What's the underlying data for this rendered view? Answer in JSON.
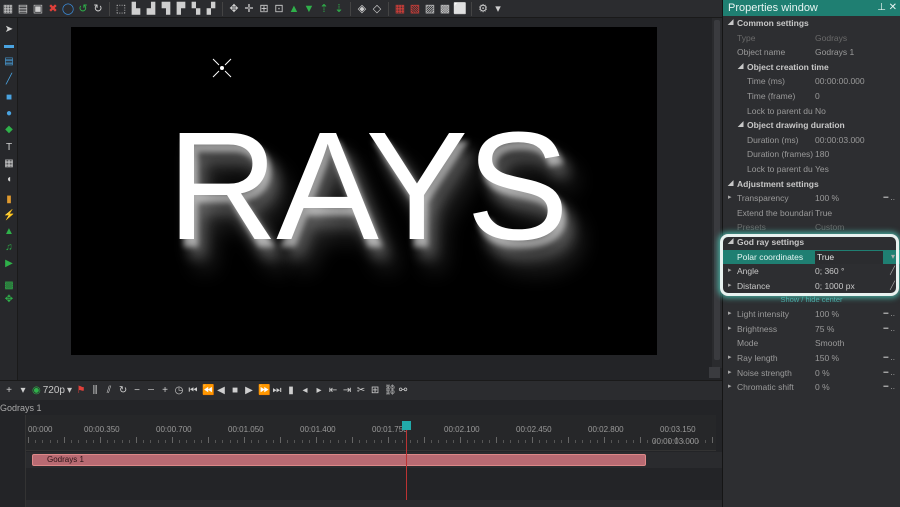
{
  "canvas": {
    "text": "RAYS"
  },
  "timeline": {
    "resolution": "720p",
    "track_name": "Godrays 1",
    "clip_label": "Godrays 1",
    "ticks": [
      "00:000",
      "00:00.350",
      "00:00.700",
      "00:01.050",
      "00:01.400",
      "00:01.750",
      "00:02.100",
      "00:02.450",
      "00:02.800",
      "00:03.150"
    ],
    "end_time": "00:00:03.000"
  },
  "properties": {
    "title": "Properties window",
    "pin_icon": "pin-icon",
    "close_icon": "close-icon",
    "common_settings": "Common settings",
    "type_key": "Type",
    "type_val": "Godrays",
    "object_name_key": "Object name",
    "object_name_val": "Godrays 1",
    "creation_time": "Object creation time",
    "time_ms_key": "Time (ms)",
    "time_ms_val": "00:00:00.000",
    "time_frame_key": "Time (frame)",
    "time_frame_val": "0",
    "lock1_key": "Lock to parent du",
    "lock1_val": "No",
    "drawing_duration": "Object drawing duration",
    "duration_ms_key": "Duration (ms)",
    "duration_ms_val": "00:00:03.000",
    "duration_frames_key": "Duration (frames)",
    "duration_frames_val": "180",
    "lock2_key": "Lock to parent du",
    "lock2_val": "Yes",
    "adjustment_settings": "Adjustment settings",
    "transparency_key": "Transparency",
    "transparency_val": "100 %",
    "extend_key": "Extend the boundari",
    "extend_val": "True",
    "presets_key": "Presets",
    "presets_val": "Custom",
    "godray_settings": "God ray settings",
    "polar_key": "Polar coordinates",
    "polar_val": "True",
    "angle_key": "Angle",
    "angle_val": "0; 360 °",
    "distance_key": "Distance",
    "distance_val": "0; 1000 px",
    "show_hide": "Show / hide center",
    "light_key": "Light intensity",
    "light_val": "100 %",
    "brightness_key": "Brightness",
    "brightness_val": "75 %",
    "mode_key": "Mode",
    "mode_val": "Smooth",
    "ray_length_key": "Ray length",
    "ray_length_val": "150 %",
    "noise_key": "Noise strength",
    "noise_val": "0 %",
    "chromatic_key": "Chromatic shift",
    "chromatic_val": "0 %"
  }
}
